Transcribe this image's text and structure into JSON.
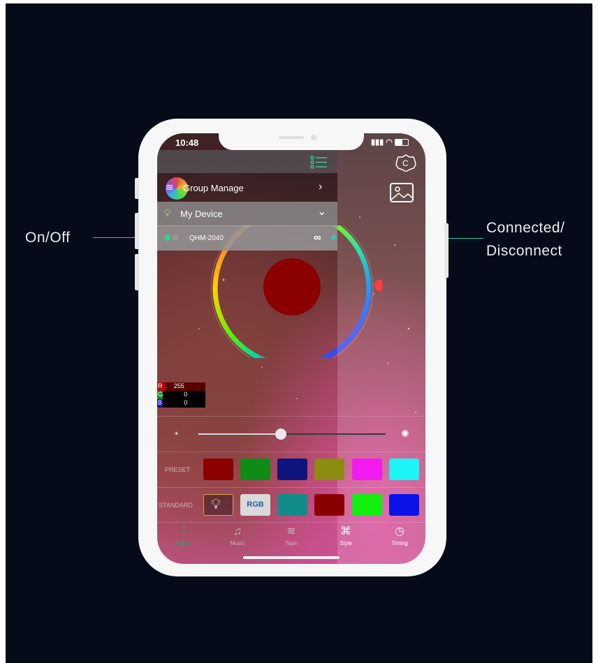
{
  "callouts": {
    "left": "On/Off",
    "right_line1": "Connected/",
    "right_line2": "Disconnect"
  },
  "status_bar": {
    "time": "10:48",
    "icons": "…ᴵᴵ ● ▭"
  },
  "menu": {
    "group_manage": "Group Manage",
    "my_device": "My Device",
    "device_name": "QHM-2040"
  },
  "rgb": {
    "r_label": "R",
    "r_value": "255",
    "g_label": "G",
    "g_value": "0",
    "b_label": "B",
    "b_value": "0"
  },
  "brightness_level": 0.44,
  "preset": {
    "label": "PRESET",
    "colors": [
      "#8b0000",
      "#0f8c14",
      "#10147d",
      "#8c8c10",
      "#f21cf0",
      "#1cf5f5"
    ]
  },
  "standard": {
    "label": "STANDARD",
    "rgb_button": "RGB",
    "colors": [
      "#128c8a",
      "#8a0000",
      "#10ef10",
      "#0a14e8"
    ]
  },
  "tabs": [
    {
      "label": "Adjust",
      "icon": "sliders-icon"
    },
    {
      "label": "Music",
      "icon": "music-note-icon"
    },
    {
      "label": "Tape",
      "icon": "waves-icon"
    },
    {
      "label": "Style",
      "icon": "command-icon"
    },
    {
      "label": "Timing",
      "icon": "clock-icon"
    }
  ],
  "colors": {
    "accent": "#2fc9b5",
    "active_tab": "#27a86a",
    "selected_color": "#8b0000"
  }
}
